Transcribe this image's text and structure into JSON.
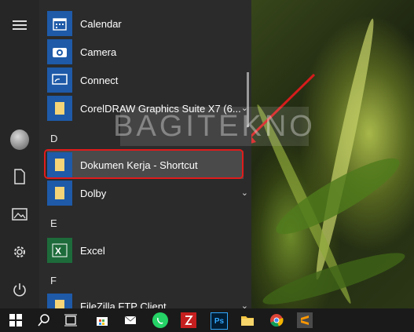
{
  "start_menu": {
    "apps": [
      {
        "label": "Calendar",
        "icon": "calendar-icon",
        "color": "#1e5aa8",
        "expandable": false
      },
      {
        "label": "Camera",
        "icon": "camera-icon",
        "color": "#1e5aa8",
        "expandable": false
      },
      {
        "label": "Connect",
        "icon": "connect-icon",
        "color": "#1e5aa8",
        "expandable": false
      },
      {
        "label": "CorelDRAW Graphics Suite X7 (6...",
        "icon": "folder-icon",
        "color": "#1e5aa8",
        "expandable": true
      }
    ],
    "letter_d": "D",
    "dokumen": {
      "label": "Dokumen Kerja - Shortcut",
      "icon": "folder-icon"
    },
    "dolby": {
      "label": "Dolby",
      "icon": "folder-icon"
    },
    "letter_e": "E",
    "excel": {
      "label": "Excel",
      "icon": "excel-icon",
      "color": "#1d6b3a"
    },
    "letter_f": "F",
    "filezilla": {
      "label": "FileZilla FTP Client",
      "icon": "folder-icon"
    },
    "chevron": "⌄"
  },
  "watermark": "BAGITEKNO",
  "colors": {
    "highlight": "#e01b1b",
    "tile_blue": "#1e5aa8",
    "excel_green": "#1d6b3a"
  },
  "taskbar": {
    "items": [
      "start-icon",
      "search-icon",
      "task-view-icon",
      "store-icon",
      "mail-icon",
      "whatsapp-icon",
      "filezilla-icon",
      "photoshop-icon",
      "file-explorer-icon",
      "chrome-icon",
      "sublime-icon"
    ],
    "ps_label": "Ps"
  }
}
